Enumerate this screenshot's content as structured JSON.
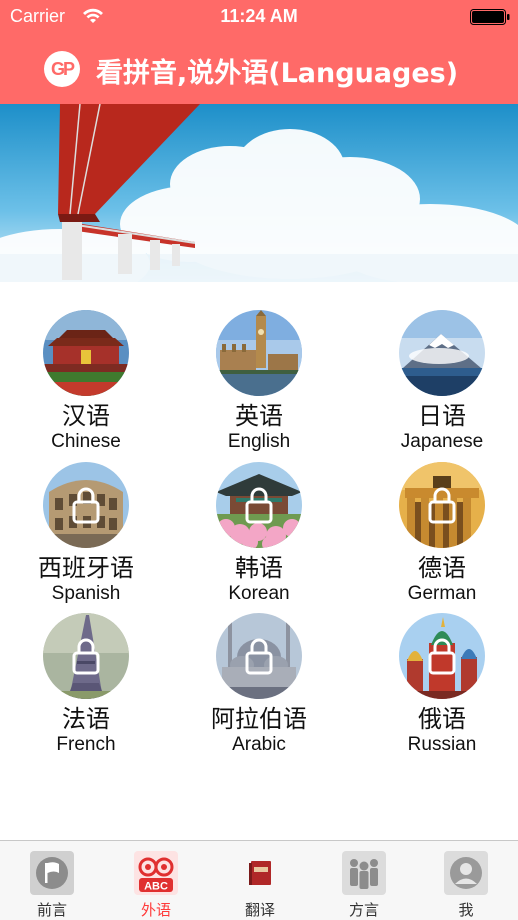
{
  "status_bar": {
    "carrier": "Carrier",
    "time": "11:24 AM"
  },
  "nav": {
    "logo_text": "GP",
    "title": "看拼音,说外语(Languages)"
  },
  "languages": [
    {
      "cn": "汉语",
      "en": "Chinese",
      "locked": false
    },
    {
      "cn": "英语",
      "en": "English",
      "locked": false
    },
    {
      "cn": "日语",
      "en": "Japanese",
      "locked": false
    },
    {
      "cn": "西班牙语",
      "en": "Spanish",
      "locked": true
    },
    {
      "cn": "韩语",
      "en": "Korean",
      "locked": true
    },
    {
      "cn": "德语",
      "en": "German",
      "locked": true
    },
    {
      "cn": "法语",
      "en": "French",
      "locked": true
    },
    {
      "cn": "阿拉伯语",
      "en": "Arabic",
      "locked": true
    },
    {
      "cn": "俄语",
      "en": "Russian",
      "locked": true
    }
  ],
  "tabs": [
    {
      "label": "前言",
      "icon": "flag-icon",
      "active": false
    },
    {
      "label": "外语",
      "icon": "abc-owl-icon",
      "active": true
    },
    {
      "label": "翻译",
      "icon": "dictionary-book-icon",
      "active": false
    },
    {
      "label": "方言",
      "icon": "people-group-icon",
      "active": false
    },
    {
      "label": "我",
      "icon": "user-profile-icon",
      "active": false
    }
  ],
  "colors": {
    "accent": "#ff6a68",
    "active_tab": "#ff3b3b"
  }
}
